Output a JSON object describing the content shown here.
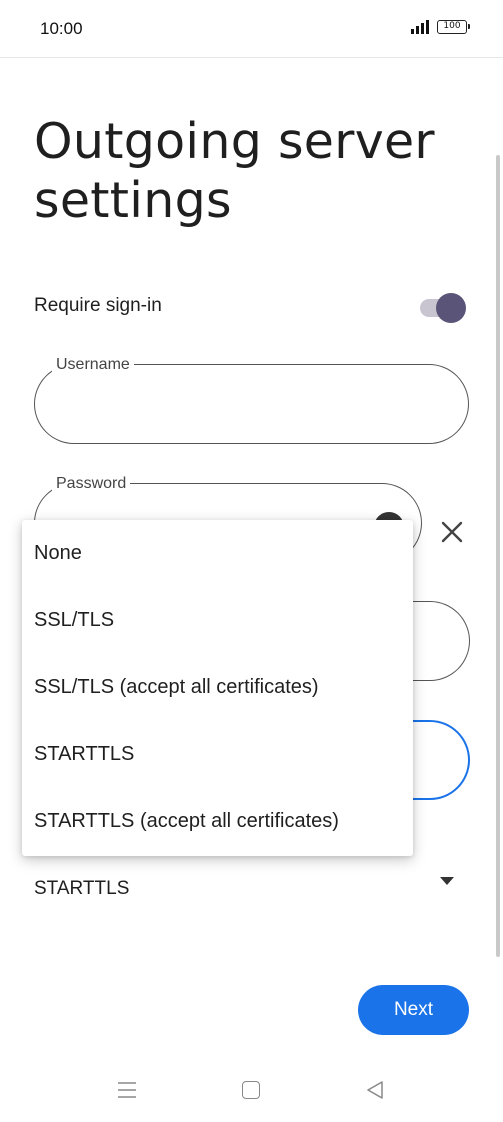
{
  "status_bar": {
    "time": "10:00",
    "battery": "100"
  },
  "page": {
    "title": "Outgoing server settings"
  },
  "require_signin": {
    "label": "Require sign-in",
    "enabled": true
  },
  "fields": {
    "username_label": "Username",
    "username_value": "",
    "password_label": "Password",
    "password_value": ""
  },
  "security": {
    "selected": "STARTTLS"
  },
  "dropdown": {
    "options": [
      "None",
      "SSL/TLS",
      "SSL/TLS (accept all certificates)",
      "STARTTLS",
      "STARTTLS (accept all certificates)"
    ]
  },
  "actions": {
    "next_label": "Next"
  },
  "icons": {
    "signal": "signal-icon",
    "battery": "battery-icon",
    "eye": "eye-icon",
    "clear": "clear-icon",
    "dropdown_arrow": "dropdown-arrow-icon",
    "nav_recents": "recents-icon",
    "nav_home": "home-icon",
    "nav_back": "back-icon"
  },
  "colors": {
    "accent": "#1a73e8",
    "toggle_thumb": "#5a5478",
    "toggle_track": "#c8c5d0"
  }
}
